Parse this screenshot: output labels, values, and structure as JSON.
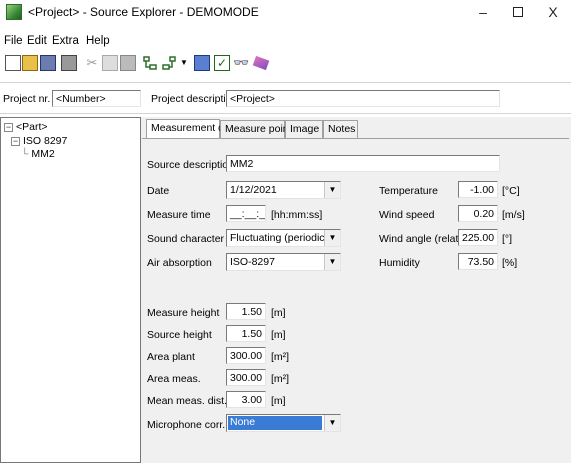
{
  "window": {
    "title": "<Project> - Source Explorer - DEMOMODE",
    "minimize": "–",
    "close": "X"
  },
  "menu": [
    "File",
    "Edit",
    "Extra",
    "Help"
  ],
  "toolbar_icons": [
    "new-document-icon",
    "open-folder-icon",
    "save-disk-icon",
    "print-icon",
    "cut-icon",
    "copy-icon",
    "paste-icon",
    "tree-expand-icon",
    "tree-collapse-icon",
    "dropdown-arrow-icon",
    "grid-icon",
    "checkbox-icon",
    "binoculars-icon",
    "eraser-icon"
  ],
  "header": {
    "project_nr_label": "Project nr.",
    "project_nr_value": "<Number>",
    "project_desc_label": "Project description",
    "project_desc_value": "<Project>"
  },
  "tree": {
    "root": "<Part>",
    "child": "ISO 8297",
    "leaf": "MM2"
  },
  "tabs": [
    "Measurement data",
    "Measure points",
    "Image",
    "Notes"
  ],
  "form": {
    "source_description": {
      "label": "Source description",
      "value": "MM2"
    },
    "date": {
      "label": "Date",
      "value": "1/12/2021"
    },
    "measure_time": {
      "label": "Measure time",
      "value": "__:__:__",
      "unit": "[hh:mm:ss]"
    },
    "sound_character": {
      "label": "Sound character",
      "value": "Fluctuating (periodic)"
    },
    "air_absorption": {
      "label": "Air absorption",
      "value": "ISO-8297"
    },
    "temperature": {
      "label": "Temperature",
      "value": "-1.00",
      "unit": "[°C]"
    },
    "wind_speed": {
      "label": "Wind speed",
      "value": "0.20",
      "unit": "[m/s]"
    },
    "wind_angle": {
      "label": "Wind angle (relative)",
      "value": "225.00",
      "unit": "[°]"
    },
    "humidity": {
      "label": "Humidity",
      "value": "73.50",
      "unit": "[%]"
    },
    "measure_height": {
      "label": "Measure height",
      "value": "1.50",
      "unit": "[m]"
    },
    "source_height": {
      "label": "Source height",
      "value": "1.50",
      "unit": "[m]"
    },
    "area_plant": {
      "label": "Area plant",
      "value": "300.00",
      "unit": "[m²]"
    },
    "area_meas": {
      "label": "Area meas.",
      "value": "300.00",
      "unit": "[m²]"
    },
    "mean_meas_dist": {
      "label": "Mean meas. dist.",
      "value": "3.00",
      "unit": "[m]"
    },
    "microphone_corr": {
      "label": "Microphone corr.",
      "value": "None"
    }
  },
  "colors": {
    "selection": "#3a7bd5",
    "panel_bg": "#f0f0f0"
  }
}
